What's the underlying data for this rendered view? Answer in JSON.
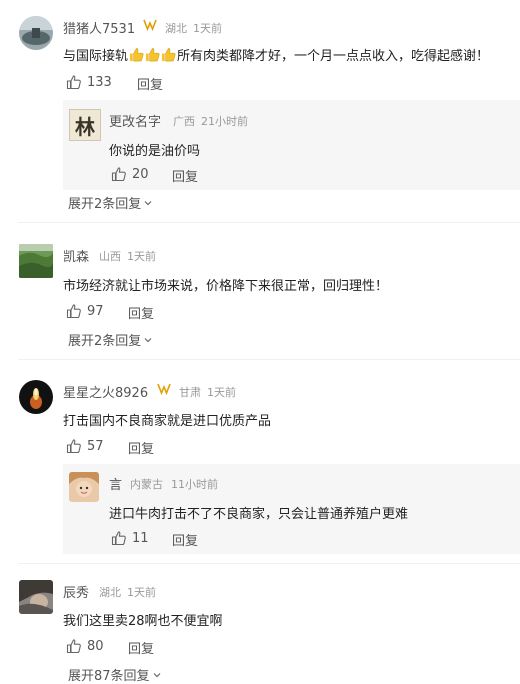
{
  "icons": {
    "like": "thumbs-up-icon",
    "expand": "chevron-down-icon",
    "badge": "verified-badge-icon",
    "emoji": "thumbs-up-emoji"
  },
  "colors": {
    "badge": "#e0a000",
    "emoji": "#f5c32c"
  },
  "comments": [
    {
      "name": "猎猪人7531",
      "location": "湖北",
      "time": "1天前",
      "text": "与国际接轨",
      "text_after_emoji": "所有肉类都降才好，一个月一点点收入，吃得起感谢！",
      "likes": "133",
      "reply_label": "回复",
      "sub": {
        "name": "更改名字",
        "location": "广西",
        "time": "21小时前",
        "text": "你说的是油价吗",
        "likes": "20",
        "reply_label": "回复",
        "avatar_char": "林"
      },
      "expand": "展开2条回复"
    },
    {
      "name": "凯森",
      "location": "山西",
      "time": "1天前",
      "text": "市场经济就让市场来说，价格降下来很正常，回归理性！",
      "likes": "97",
      "reply_label": "回复",
      "expand": "展开2条回复"
    },
    {
      "name": "星星之火8926",
      "location": "甘肃",
      "time": "1天前",
      "text": "打击国内不良商家就是进口优质产品",
      "likes": "57",
      "reply_label": "回复",
      "sub": {
        "name": "言",
        "location": "内蒙古",
        "time": "11小时前",
        "text": "进口牛肉打击不了不良商家，只会让普通养殖户更难",
        "likes": "11",
        "reply_label": "回复"
      }
    },
    {
      "name": "辰秀",
      "location": "湖北",
      "time": "1天前",
      "text": "我们这里卖28啊也不便宜啊",
      "likes": "80",
      "reply_label": "回复",
      "expand": "展开87条回复"
    }
  ]
}
